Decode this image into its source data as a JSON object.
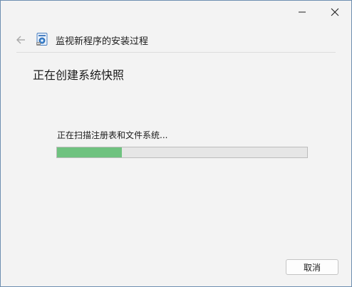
{
  "window": {
    "header_title": "监视新程序的安装过程"
  },
  "page": {
    "title": "正在创建系统快照",
    "status_text": "正在扫描注册表和文件系统...",
    "progress_percent": 26
  },
  "buttons": {
    "cancel_label": "取消"
  },
  "colors": {
    "progress_fill": "#6fc27f",
    "progress_track": "#e6e6e6",
    "background": "#f3f3f3"
  },
  "icons": {
    "minimize": "minimize-icon",
    "close": "close-icon",
    "back": "back-arrow-icon",
    "app": "installation-monitor-icon"
  }
}
